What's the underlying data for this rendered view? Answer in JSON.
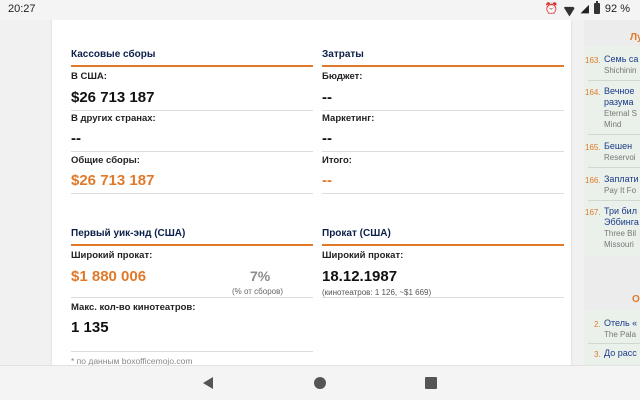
{
  "status_bar": {
    "time": "20:27",
    "battery": "92 %"
  },
  "box_office": {
    "title": "Кассовые сборы",
    "usa_label": "В США:",
    "usa_value": "$26 713 187",
    "other_label": "В других странах:",
    "other_value": "--",
    "total_label": "Общие сборы:",
    "total_value": "$26 713 187"
  },
  "costs": {
    "title": "Затраты",
    "budget_label": "Бюджет:",
    "budget_value": "--",
    "marketing_label": "Маркетинг:",
    "marketing_value": "--",
    "total_label": "Итого:",
    "total_value": "--"
  },
  "opening_weekend": {
    "title": "Первый уик-энд (США)",
    "wide_label": "Широкий прокат:",
    "wide_value": "$1 880 006",
    "percent": "7%",
    "percent_note": "(% от сборов)",
    "theaters_label": "Макс. кол-во кинотеатров:",
    "theaters_value": "1 135"
  },
  "release": {
    "title": "Прокат (США)",
    "wide_label": "Широкий прокат:",
    "wide_date": "18.12.1987",
    "wide_note": "(кинотеатров: 1 126, ~$1 669)"
  },
  "footnote": "* по данным boxofficemojo.com",
  "sidebar": {
    "heading1": "Лу",
    "items": [
      {
        "num": "163.",
        "title": "Семь са",
        "sub": "Shichinin"
      },
      {
        "num": "164.",
        "title": "Вечное",
        "title2": "разума",
        "sub": "Eternal S",
        "sub2": "Mind"
      },
      {
        "num": "165.",
        "title": "Бешен",
        "sub": "Reservoi"
      },
      {
        "num": "166.",
        "title": "Заплати",
        "sub": "Pay It Fo"
      },
      {
        "num": "167.",
        "title": "Три бил",
        "title2": "Эббинга",
        "sub": "Three Bil",
        "sub2": "Missouri"
      }
    ],
    "heading2": "Оз",
    "items2": [
      {
        "num": "2.",
        "title": "Отель «",
        "sub": "The Pala"
      },
      {
        "num": "3.",
        "title": "До расс"
      }
    ]
  },
  "colors": {
    "accent": "#e07a2a",
    "heading": "#0b1f4a",
    "link": "#1a3a8a"
  },
  "nav": {
    "back_icon": "back-triangle-icon",
    "home_icon": "home-circle-icon",
    "recent_icon": "recent-square-icon"
  }
}
